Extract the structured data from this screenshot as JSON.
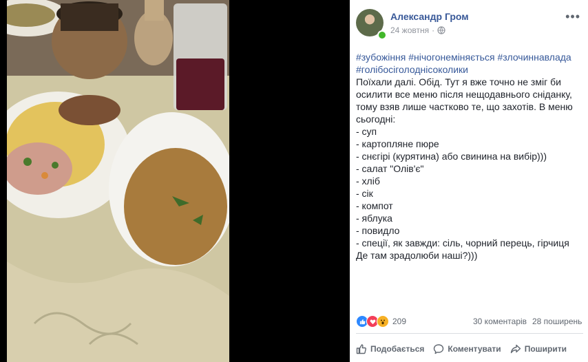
{
  "post": {
    "author": "Александр Гром",
    "date": "24 жовтня",
    "hashtags_line1": "#зубожіння #нічогонеміняється #злочиннавлада",
    "hashtags_line2": "#голібосіголоднісоколики",
    "body_lines": [
      "Поїхали далі. Обід. Тут я вже точно не зміг би",
      "осилити все меню після нещодавнього сніданку,",
      "тому взяв лише частково те, що захотів. В меню",
      "сьогодні:",
      "- суп",
      "- картопляне пюре",
      "- снєгірі (курятина) або свинина на вибір)))",
      "- салат \"Олів'є\"",
      "- хліб",
      "- сік",
      "- компот",
      "- яблука",
      "- повидло",
      "- спеції, як завжди: сіль, чорний перець, гірчиця",
      "Де там зрадолюби наші?)))"
    ]
  },
  "stats": {
    "reactions_count": "209",
    "comments": "30 коментарів",
    "shares": "28 поширень"
  },
  "actions": {
    "like": "Подобається",
    "comment": "Коментувати",
    "share": "Поширити"
  },
  "icons": {
    "privacy": "globe-icon",
    "more": "more-options-icon",
    "like": "thumbs-up-icon",
    "comment": "comment-bubble-icon",
    "share": "share-arrow-icon"
  },
  "colors": {
    "link": "#385898",
    "hashtag": "#365899",
    "online": "#42b72a"
  }
}
